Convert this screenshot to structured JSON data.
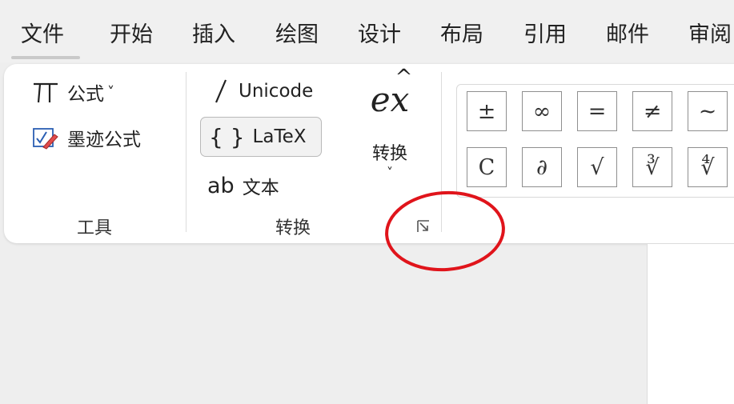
{
  "tabs": [
    "文件",
    "开始",
    "插入",
    "绘图",
    "设计",
    "布局",
    "引用",
    "邮件",
    "审阅"
  ],
  "tools": {
    "group_label": "工具",
    "equation_label": "公式",
    "equation_chevron": "˅",
    "ink_equation_label": "墨迹公式"
  },
  "conversions": {
    "group_label": "转换",
    "unicode_label": "Unicode",
    "latex_label": "LaTeX",
    "latex_icon": "{ }",
    "text_label": "文本",
    "text_icon": "ab",
    "convert_label": "转换",
    "convert_chevron": "˅",
    "convert_icon_base": "e",
    "convert_icon_x": "x"
  },
  "symbols": {
    "row1": [
      "±",
      "∞",
      "=",
      "≠",
      "~"
    ],
    "row2": [
      "C",
      "∂",
      "√",
      "∛",
      "∜"
    ]
  },
  "colors": {
    "annotation": "#e0141b",
    "selected_bg": "#f2f2f2"
  }
}
